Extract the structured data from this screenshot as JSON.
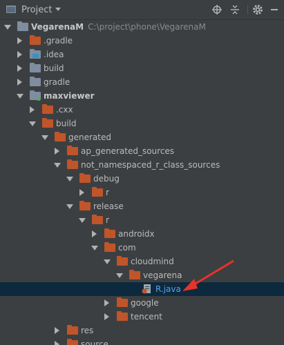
{
  "toolbar": {
    "title": "Project",
    "icons": [
      "project-icon",
      "locate-icon",
      "collapse-all-icon",
      "gear-icon",
      "hide-icon"
    ]
  },
  "tree": {
    "rows": [
      {
        "label": "VegarenaM",
        "path": "C:\\project\\phone\\VegarenaM",
        "bold": true,
        "expanded": true,
        "folder": "gray"
      },
      {
        "label": ".gradle",
        "expanded": false,
        "folder": "orange"
      },
      {
        "label": ".idea",
        "expanded": false,
        "folder": "gray-blue"
      },
      {
        "label": "build",
        "expanded": false,
        "folder": "gray"
      },
      {
        "label": "gradle",
        "expanded": false,
        "folder": "gray"
      },
      {
        "label": "maxviewer",
        "bold": true,
        "expanded": true,
        "folder": "gray-green"
      },
      {
        "label": ".cxx",
        "expanded": false,
        "folder": "orange"
      },
      {
        "label": "build",
        "expanded": true,
        "folder": "orange"
      },
      {
        "label": "generated",
        "expanded": true,
        "folder": "orange"
      },
      {
        "label": "ap_generated_sources",
        "expanded": false,
        "folder": "orange"
      },
      {
        "label": "not_namespaced_r_class_sources",
        "expanded": true,
        "folder": "orange"
      },
      {
        "label": "debug",
        "expanded": true,
        "folder": "orange"
      },
      {
        "label": "r",
        "expanded": false,
        "folder": "orange"
      },
      {
        "label": "release",
        "expanded": true,
        "folder": "orange"
      },
      {
        "label": "r",
        "expanded": true,
        "folder": "orange"
      },
      {
        "label": "androidx",
        "expanded": false,
        "folder": "orange"
      },
      {
        "label": "com",
        "expanded": true,
        "folder": "orange"
      },
      {
        "label": "cloudmind",
        "expanded": true,
        "folder": "orange"
      },
      {
        "label": "vegarena",
        "expanded": true,
        "folder": "orange"
      },
      {
        "label": "R.java",
        "file": true,
        "selected": true
      },
      {
        "label": "google",
        "expanded": false,
        "folder": "orange"
      },
      {
        "label": "tencent",
        "expanded": false,
        "folder": "orange"
      },
      {
        "label": "res",
        "expanded": false,
        "folder": "orange"
      },
      {
        "label": "source",
        "expanded": false,
        "folder": "orange"
      }
    ]
  },
  "colors": {
    "background": "#3c3f41",
    "selection": "#0d293e",
    "folder": "#c0552a",
    "annotation": "#e8322b"
  }
}
